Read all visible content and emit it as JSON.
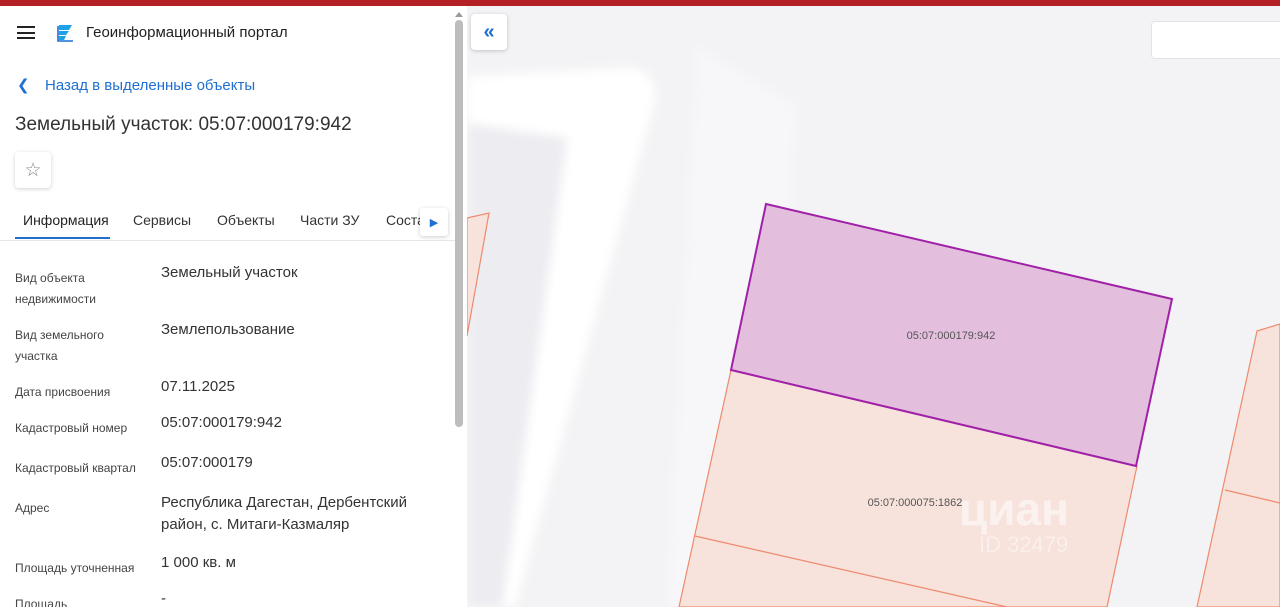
{
  "header": {
    "title": "Геоинформационный портал",
    "menu_icon": "hamburger-icon",
    "logo_icon": "portal-logo-icon"
  },
  "back_link": {
    "label": "Назад в выделенные объекты"
  },
  "object": {
    "title": "Земельный участок: 05:07:000179:942"
  },
  "tabs": [
    {
      "label": "Информация",
      "active": true
    },
    {
      "label": "Сервисы"
    },
    {
      "label": "Объекты"
    },
    {
      "label": "Части ЗУ"
    },
    {
      "label": "Соста"
    }
  ],
  "info": [
    {
      "key": "Вид объекта недвижимости",
      "value": "Земельный участок"
    },
    {
      "key": "Вид земельного участка",
      "value": "Землепользование"
    },
    {
      "key": "Дата присвоения",
      "value": "07.11.2025"
    },
    {
      "key": "Кадастровый номер",
      "value": "05:07:000179:942"
    },
    {
      "key": "Кадастровый квартал",
      "value": "05:07:000179"
    },
    {
      "key": "Адрес",
      "value": "Республика Дагестан, Дербентский район, с. Митаги-Казмаляр"
    },
    {
      "key": "Площадь уточненная",
      "value": "1 000 кв. м"
    },
    {
      "key": "Площадь",
      "value": "-"
    }
  ],
  "map": {
    "parcel_selected_label": "05:07:000179:942",
    "parcel_neighbor_label": "05:07:000075:1862",
    "search_value": "",
    "watermark": "циан",
    "watermark_id": "ID 32479"
  },
  "colors": {
    "accent": "#1f6fd1",
    "topbar": "#b21f24",
    "selected_fill": "#e3bedd",
    "selected_stroke": "#a020a8",
    "parcel_fill": "#f7e2dc",
    "parcel_stroke": "#ee8a6e"
  }
}
